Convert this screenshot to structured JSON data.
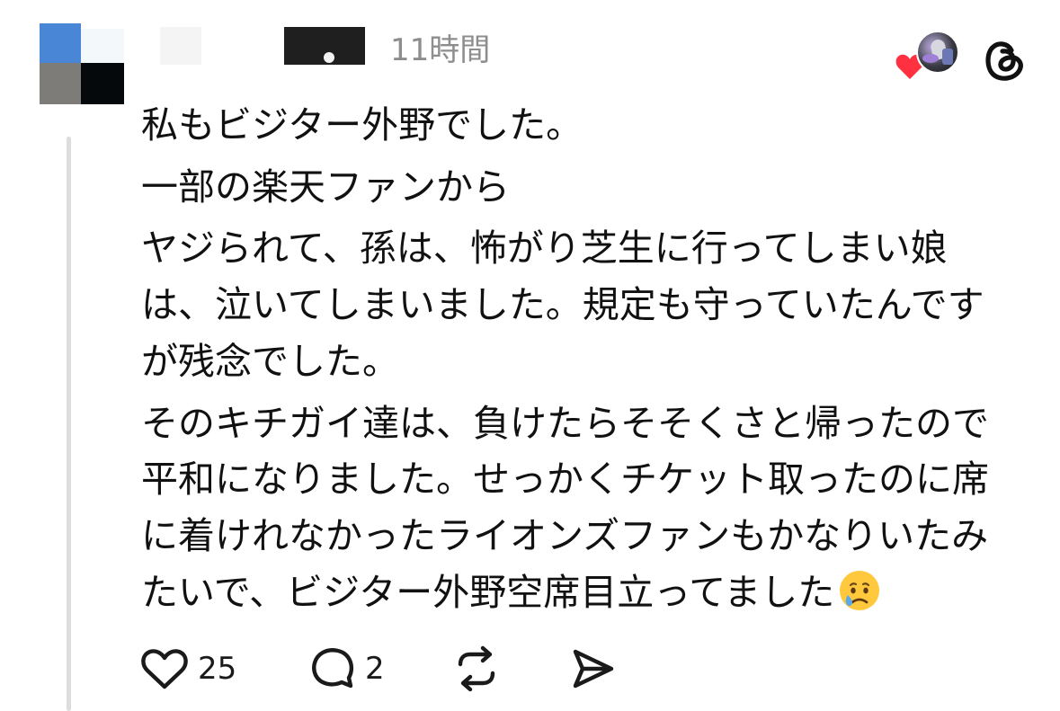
{
  "post": {
    "timestamp": "11時間",
    "lines": [
      "私もビジター外野でした。",
      "一部の楽天ファンから",
      "ヤジられて、孫は、怖がり芝生に行ってしまい娘",
      "は、泣いてしまいました。規定も守っていたんです",
      "が残念でした。",
      "そのキチガイ達は、負けたらそそくさと帰ったので",
      "平和になりました。せっかくチケット取ったのに席",
      "に着けれなかったライオンズファンもかなりいたみ",
      "たいで、ビジター外野空席目立ってました"
    ]
  },
  "actions": {
    "like_count": "25",
    "reply_count": "2"
  },
  "icons": {
    "heart": "like-heart-icon",
    "reply": "reply-bubble-icon",
    "repost": "repost-icon",
    "share": "send-icon",
    "threads": "threads-logo-icon",
    "emoji": "crying-face-emoji"
  },
  "colors": {
    "text": "#111111",
    "muted": "#8d8d8d",
    "heart": "#ff3040",
    "thread_line": "#dddddd"
  }
}
